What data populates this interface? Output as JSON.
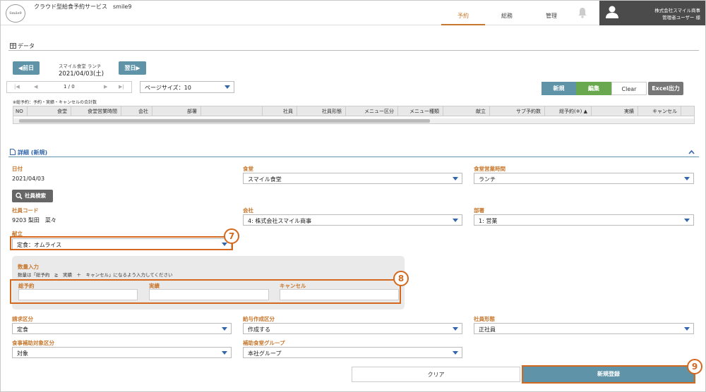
{
  "header": {
    "logo_text": "Smile9",
    "app_title": "クラウド型給食予約サービス　smile9",
    "nav": [
      {
        "label": "予約",
        "active": true
      },
      {
        "label": "総務",
        "active": false
      },
      {
        "label": "管理",
        "active": false
      }
    ],
    "company": "株式会社スマイル商事",
    "user": "管理者ユーザー 様"
  },
  "data_section": {
    "title": "データ",
    "prev_button": "◀前日",
    "next_button": "翌日▶",
    "cafeteria_label": "スマイル食堂 ランチ",
    "date": "2021/04/03(土)",
    "pager_text": "1 / 0",
    "page_size": "ページサイズ：10",
    "buttons": {
      "new": "新規",
      "edit": "編集",
      "clear": "Clear",
      "excel": "Excel出力"
    },
    "note": "※総予約：予約・実績・キャンセルの合計数",
    "columns": [
      "NO",
      "食堂",
      "食堂営業時間",
      "会社",
      "部署",
      "社員",
      "社員形態",
      "メニュー区分",
      "メニュー種類",
      "献立",
      "サブ予約数",
      "総予約(※) ▲",
      "実績",
      "キャンセル"
    ]
  },
  "detail_section": {
    "title": "詳細 (新規)",
    "date_label": "日付",
    "date_value": "2021/04/03",
    "cafeteria_label": "食堂",
    "cafeteria_value": "スマイル食堂",
    "hours_label": "食堂営業時間",
    "hours_value": "ランチ",
    "search_button": "社員検索",
    "emp_code_label": "社員コード",
    "emp_code_value": "9203  梨田　菜々",
    "company_label": "会社",
    "company_value": "4: 株式会社スマイル商事",
    "dept_label": "部署",
    "dept_value": "1: 営業",
    "menu_label": "献立",
    "menu_value": "定食：オムライス",
    "qty_title": "数量入力",
    "qty_note": "数量は「総予約　≧　実績　＋　キャンセル」になるよう入力してください",
    "qty_total_label": "総予約",
    "qty_actual_label": "実績",
    "qty_cancel_label": "キャンセル",
    "billing_label": "請求区分",
    "billing_value": "定食",
    "payroll_label": "給与作成区分",
    "payroll_value": "作成する",
    "emp_type_label": "社員形態",
    "emp_type_value": "正社員",
    "subsidy_label": "食事補助対象区分",
    "subsidy_value": "対象",
    "subsidy_group_label": "補助食堂グループ",
    "subsidy_group_value": "本社グループ",
    "clear_button": "クリア",
    "register_button": "新規登録"
  },
  "annotations": {
    "n7": "7",
    "n8": "8",
    "n9": "9"
  },
  "colors": {
    "accent": "#c8782e",
    "primary": "#5e93a8",
    "edit": "#6aa84f",
    "highlight": "#d2691e"
  }
}
